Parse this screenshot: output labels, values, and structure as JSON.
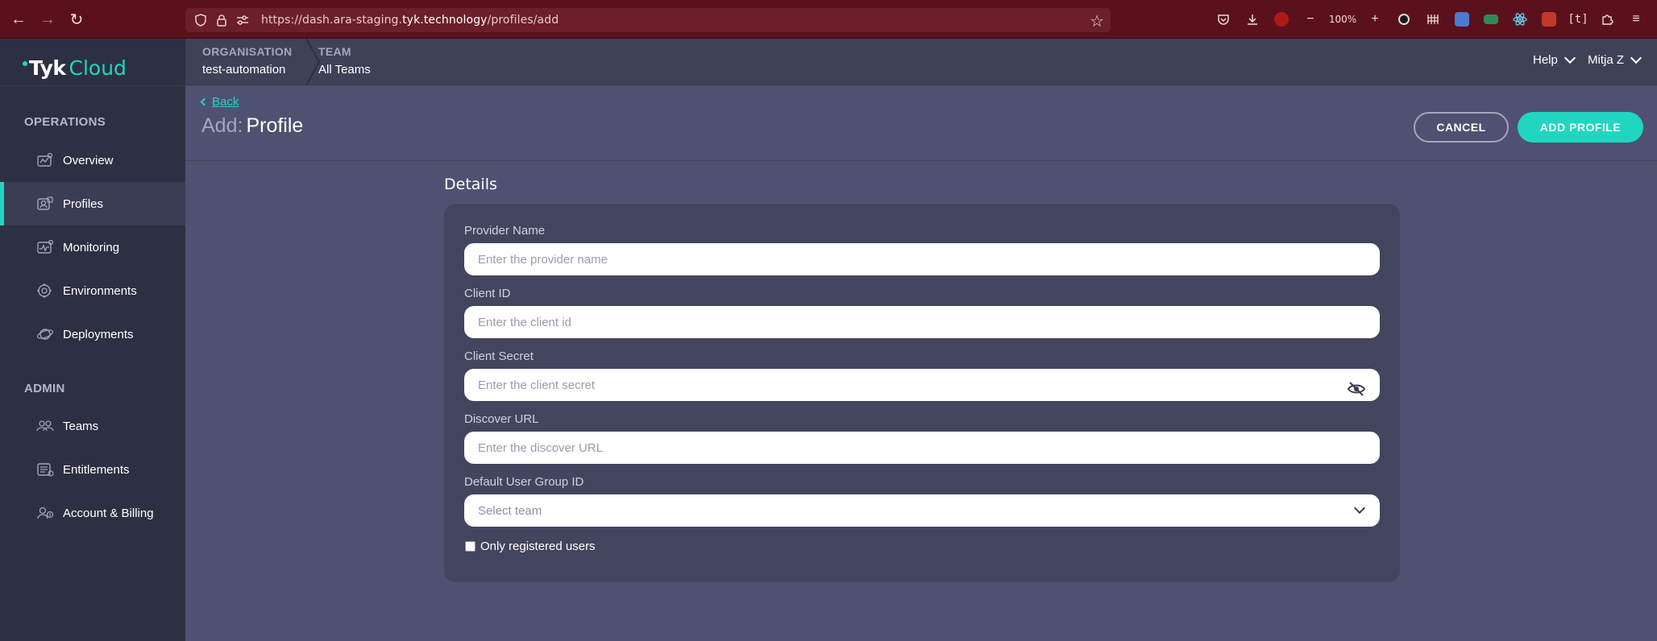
{
  "browser": {
    "url_prefix": "https://dash.ara-staging.",
    "url_domain": "tyk.technology",
    "url_path": "/profiles/add",
    "zoom": "100%"
  },
  "brand": {
    "name_bold": "Tyk",
    "name_light": "Cloud",
    "accent": "#21d6c1"
  },
  "sidebar": {
    "sections": [
      {
        "title": "OPERATIONS",
        "items": [
          {
            "label": "Overview",
            "icon": "overview-icon"
          },
          {
            "label": "Profiles",
            "icon": "profiles-icon",
            "active": true
          },
          {
            "label": "Monitoring",
            "icon": "monitoring-icon"
          },
          {
            "label": "Environments",
            "icon": "environments-icon"
          },
          {
            "label": "Deployments",
            "icon": "deployments-icon"
          }
        ]
      },
      {
        "title": "ADMIN",
        "items": [
          {
            "label": "Teams",
            "icon": "teams-icon"
          },
          {
            "label": "Entitlements",
            "icon": "entitlements-icon"
          },
          {
            "label": "Account & Billing",
            "icon": "account-billing-icon"
          }
        ]
      }
    ]
  },
  "header": {
    "organisation_key": "ORGANISATION",
    "organisation_value": "test-automation",
    "team_key": "TEAM",
    "team_value": "All Teams",
    "help": "Help",
    "user": "Mitja Z"
  },
  "page": {
    "back": "Back",
    "title_prefix": "Add:",
    "title": "Profile",
    "cancel": "CANCEL",
    "add": "ADD PROFILE",
    "section": "Details"
  },
  "form": {
    "provider_name": {
      "label": "Provider Name",
      "placeholder": "Enter the provider name"
    },
    "client_id": {
      "label": "Client ID",
      "placeholder": "Enter the client id"
    },
    "client_secret": {
      "label": "Client Secret",
      "placeholder": "Enter the client secret"
    },
    "discover_url": {
      "label": "Discover URL",
      "placeholder": "Enter the discover URL"
    },
    "default_group": {
      "label": "Default User Group ID",
      "placeholder": "Select team"
    },
    "only_registered": {
      "label": "Only registered users",
      "checked": false
    }
  }
}
